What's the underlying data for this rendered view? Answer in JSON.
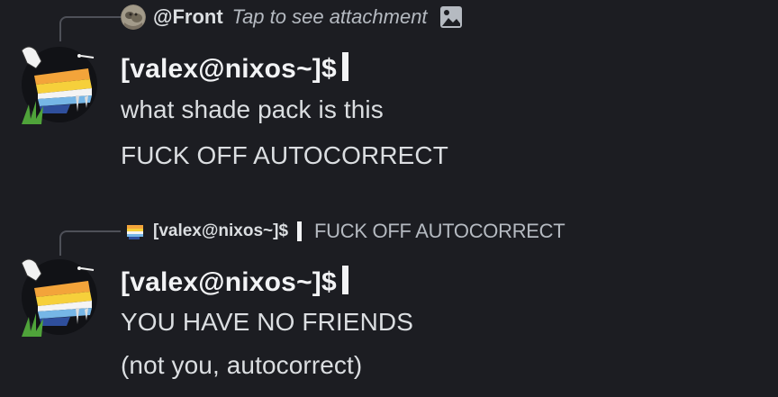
{
  "messages": [
    {
      "reply": {
        "author": "@Front",
        "preview": "Tap to see attachment",
        "attachment_icon": "image-icon"
      },
      "author": "[valex@nixos~]$",
      "lines": [
        "what shade pack is this",
        "FUCK OFF AUTOCORRECT"
      ]
    },
    {
      "reply": {
        "author": "[valex@nixos~]$",
        "content": "FUCK OFF AUTOCORRECT"
      },
      "author": "[valex@nixos~]$",
      "lines": [
        "YOU HAVE NO FRIENDS",
        "(not you, autocorrect)"
      ]
    }
  ],
  "colors": {
    "background": "#1c1d22",
    "author": "#f2f3f5",
    "text": "#dbdee1",
    "muted": "#b5bac1"
  }
}
